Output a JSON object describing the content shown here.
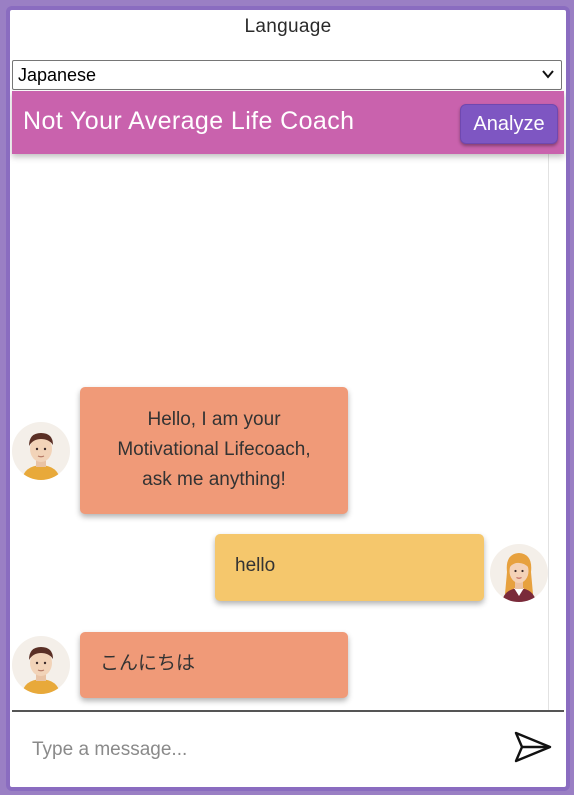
{
  "language": {
    "label": "Language",
    "selected": "Japanese"
  },
  "header": {
    "title": "Not Your Average Life Coach",
    "analyze_label": "Analyze"
  },
  "messages": [
    {
      "sender": "bot",
      "lines": [
        "Hello, I am your",
        "Motivational Lifecoach,",
        "ask me anything!"
      ]
    },
    {
      "sender": "user",
      "text": "hello"
    },
    {
      "sender": "bot",
      "text": "こんにちは"
    }
  ],
  "composer": {
    "placeholder": "Type a message...",
    "value": ""
  },
  "colors": {
    "frame": "#8a6cc0",
    "header": "#c962ad",
    "analyze_button": "#7e56c2",
    "bot_bubble": "#f09a78",
    "user_bubble": "#f5c76c"
  },
  "icons": {
    "bot_avatar": "male-avatar-icon",
    "user_avatar": "female-avatar-icon",
    "send": "send-icon",
    "dropdown": "chevron-down-icon"
  }
}
